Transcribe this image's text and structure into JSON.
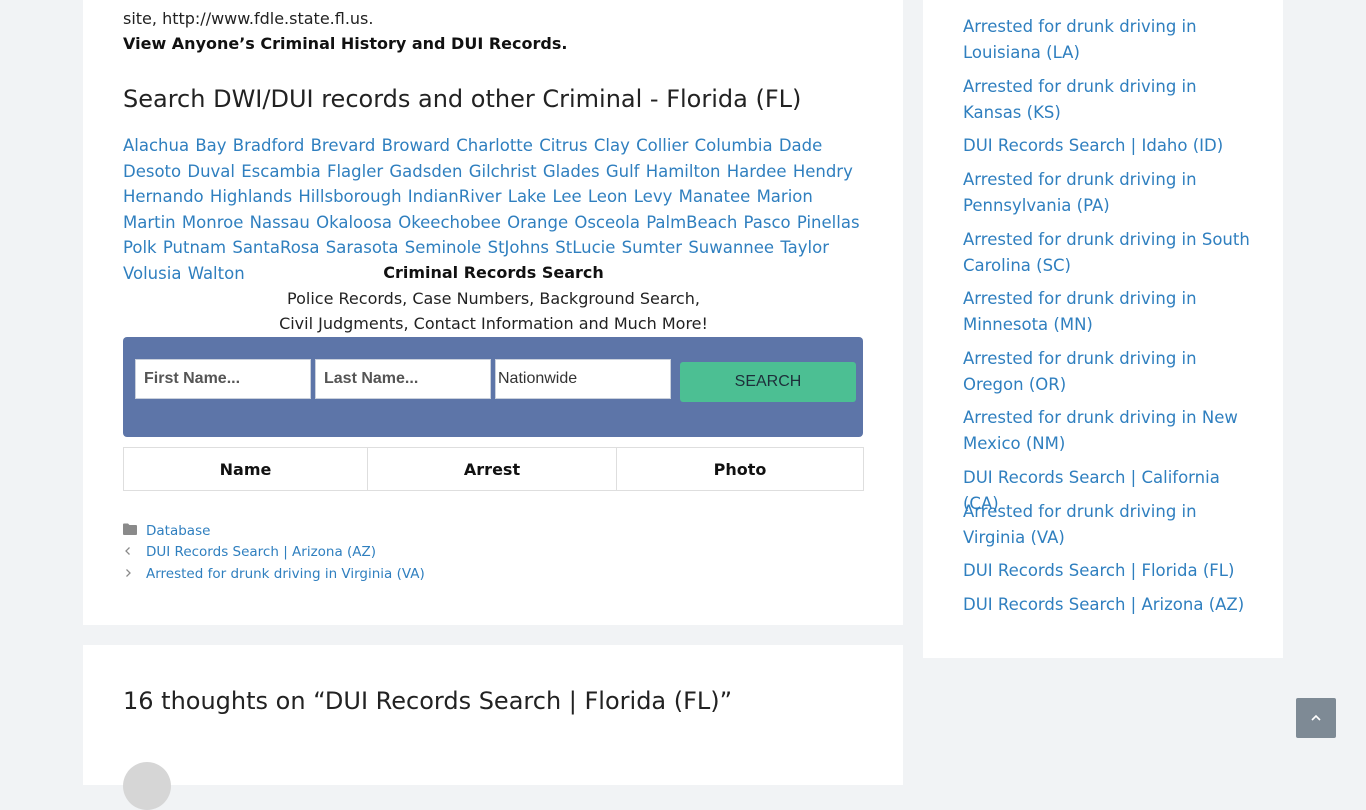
{
  "intro": {
    "site_line": "site, http://www.fdle.state.fl.us.",
    "bold_line": "View Anyone’s Criminal History and DUI Records."
  },
  "section_heading": "Search DWI/DUI records and other Criminal - Florida (FL)",
  "counties": [
    "Alachua",
    "Bay",
    "Bradford",
    "Brevard",
    "Broward",
    "Charlotte",
    "Citrus",
    "Clay",
    "Collier",
    "Columbia",
    "Dade",
    "Desoto",
    "Duval",
    "Escambia",
    "Flagler",
    "Gadsden",
    "Gilchrist",
    "Glades",
    "Gulf",
    "Hamilton",
    "Hardee",
    "Hendry",
    "Hernando",
    "Highlands",
    "Hillsborough",
    "IndianRiver",
    "Lake",
    "Lee",
    "Leon",
    "Levy",
    "Manatee",
    "Marion",
    "Martin",
    "Monroe",
    "Nassau",
    "Okaloosa",
    "Okeechobee",
    "Orange",
    "Osceola",
    "PalmBeach",
    "Pasco",
    "Pinellas",
    "Polk",
    "Putnam",
    "SantaRosa",
    "Sarasota",
    "Seminole",
    "StJohns",
    "StLucie",
    "Sumter",
    "Suwannee",
    "Taylor",
    "Volusia",
    "Walton"
  ],
  "criminal_records": {
    "title": "Criminal Records Search",
    "line1": "Police Records, Case Numbers, Background Search,",
    "line2": "Civil Judgments, Contact Information and Much More!"
  },
  "search_form": {
    "first_name_placeholder": "First Name...",
    "last_name_placeholder": "Last Name...",
    "location_value": "Nationwide",
    "search_label": "SEARCH"
  },
  "results_table": {
    "headers": [
      "Name",
      "Arrest",
      "Photo"
    ]
  },
  "post_meta": {
    "category": "Database",
    "prev_post": "DUI Records Search | Arizona (AZ)",
    "next_post": "Arrested for drunk driving in Virginia (VA)"
  },
  "comments_heading": "16 thoughts on “DUI Records Search | Florida (FL)”",
  "sidebar": {
    "items": [
      "Arrested for drunk driving in Louisiana (LA)",
      "Arrested for drunk driving in Kansas (KS)",
      "DUI Records Search | Idaho (ID)",
      "Arrested for drunk driving in Pennsylvania (PA)",
      "Arrested for drunk driving in South Carolina (SC)",
      "Arrested for drunk driving in Minnesota (MN)",
      "Arrested for drunk driving in Oregon (OR)",
      "Arrested for drunk driving in New Mexico (NM)",
      "DUI Records Search | California (CA)",
      "Arrested for drunk driving in Virginia (VA)",
      "DUI Records Search | Florida (FL)",
      "DUI Records Search | Arizona (AZ)"
    ]
  },
  "icons": {
    "category": "folder-icon",
    "prev": "chevron-left-icon",
    "next": "chevron-right-icon",
    "back_to_top": "chevron-up-icon"
  },
  "colors": {
    "link": "#2f7fbf",
    "search_panel": "#5d75a8",
    "search_button": "#4cbf93",
    "page_background": "#f1f3f5"
  }
}
